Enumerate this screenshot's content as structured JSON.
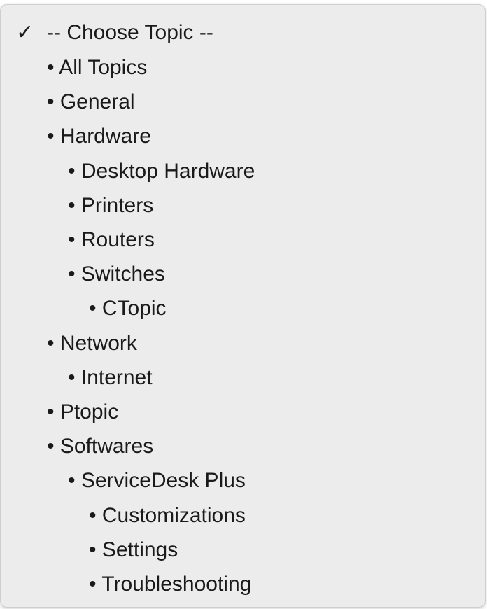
{
  "dropdown": {
    "checkmark": "✓",
    "items": [
      {
        "label": "-- Choose Topic --",
        "selected": true
      },
      {
        "label": "• All Topics"
      },
      {
        "label": "• General"
      },
      {
        "label": "• Hardware"
      },
      {
        "label": "• Desktop Hardware"
      },
      {
        "label": "• Printers"
      },
      {
        "label": "• Routers"
      },
      {
        "label": "• Switches"
      },
      {
        "label": "• CTopic"
      },
      {
        "label": "• Network"
      },
      {
        "label": "• Internet"
      },
      {
        "label": "• Ptopic"
      },
      {
        "label": "• Softwares"
      },
      {
        "label": "• ServiceDesk Plus"
      },
      {
        "label": "• Customizations"
      },
      {
        "label": "• Settings"
      },
      {
        "label": "• Troubleshooting"
      }
    ]
  }
}
